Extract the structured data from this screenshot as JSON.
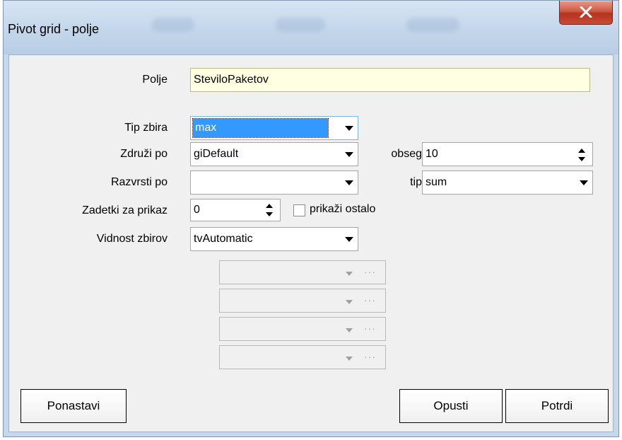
{
  "window": {
    "title": "Pivot grid - polje",
    "close_symbol": "X"
  },
  "form": {
    "polje": {
      "label": "Polje",
      "value": "SteviloPaketov"
    },
    "tip_zbira": {
      "label": "Tip zbira",
      "value": "max"
    },
    "zdruzi_po": {
      "label": "Združi po",
      "value": "giDefault"
    },
    "obseg": {
      "label": "obseg",
      "value": "10"
    },
    "razvrsti_po": {
      "label": "Razvrsti po",
      "value": ""
    },
    "tip": {
      "label": "tip",
      "value": "sum"
    },
    "zadetki": {
      "label": "Zadetki za prikaz",
      "value": "0"
    },
    "prikazi_ostalo": {
      "label": "prikaži ostalo",
      "checked": false
    },
    "vidnost": {
      "label": "Vidnost zbirov",
      "value": "tvAutomatic"
    },
    "disabled_combos": [
      "",
      "",
      "",
      ""
    ],
    "disabled_button_text": "···"
  },
  "buttons": {
    "reset": "Ponastavi",
    "cancel": "Opusti",
    "confirm": "Potrdi"
  },
  "colors": {
    "selection": "#3399ff",
    "field_highlight": "#ffffe1",
    "close_button": "#c94b35"
  }
}
